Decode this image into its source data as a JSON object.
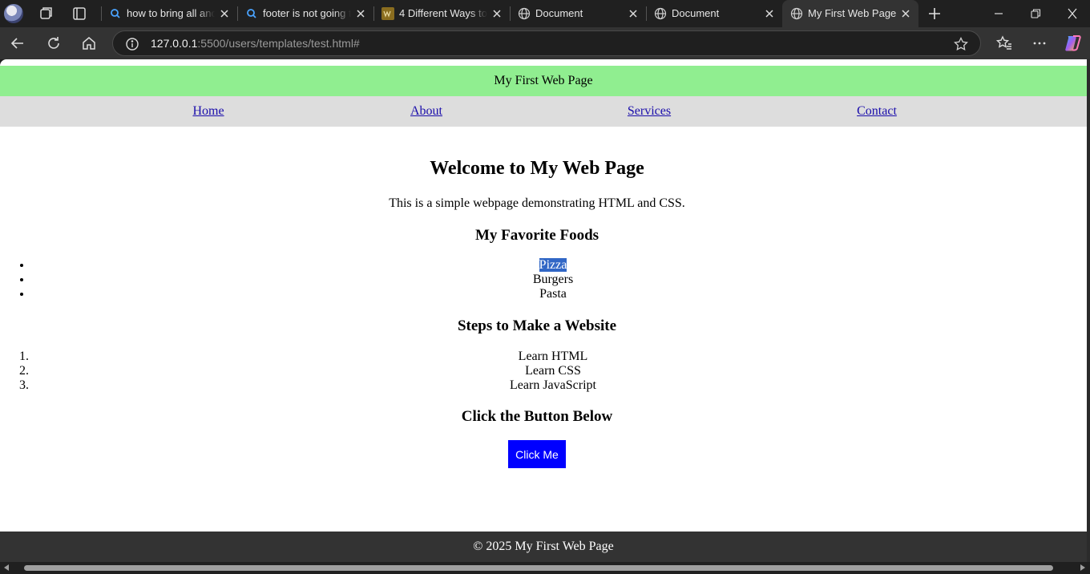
{
  "browser": {
    "tabs": [
      {
        "title": "how to bring all anchor tags",
        "favicon": "search-icon"
      },
      {
        "title": "footer is not going to bottom",
        "favicon": "search-icon"
      },
      {
        "title": "4 Different Ways to Add CSS",
        "favicon": "w3-icon"
      },
      {
        "title": "Document",
        "favicon": "globe-icon"
      },
      {
        "title": "Document",
        "favicon": "globe-icon"
      },
      {
        "title": "My First Web Page",
        "favicon": "globe-icon",
        "active": true
      }
    ],
    "url": {
      "host": "127.0.0.1",
      "rest": ":5500/users/templates/test.html#"
    }
  },
  "page": {
    "header": "My First Web Page",
    "nav": [
      "Home",
      "About",
      "Services",
      "Contact"
    ],
    "heading": "Welcome to My Web Page",
    "intro": "This is a simple webpage demonstrating HTML and CSS.",
    "foods_heading": "My Favorite Foods",
    "foods": [
      "Pizza",
      "Burgers",
      "Pasta"
    ],
    "steps_heading": "Steps to Make a Website",
    "steps": [
      "Learn HTML",
      "Learn CSS",
      "Learn JavaScript"
    ],
    "button_heading": "Click the Button Below",
    "button_label": "Click Me",
    "footer": "© 2025 My First Web Page"
  },
  "colors": {
    "header_bg": "#90ee90",
    "nav_bg": "#dddddd",
    "button_bg": "#0000ff",
    "footer_bg": "#333333",
    "selection": "#3167c6"
  }
}
